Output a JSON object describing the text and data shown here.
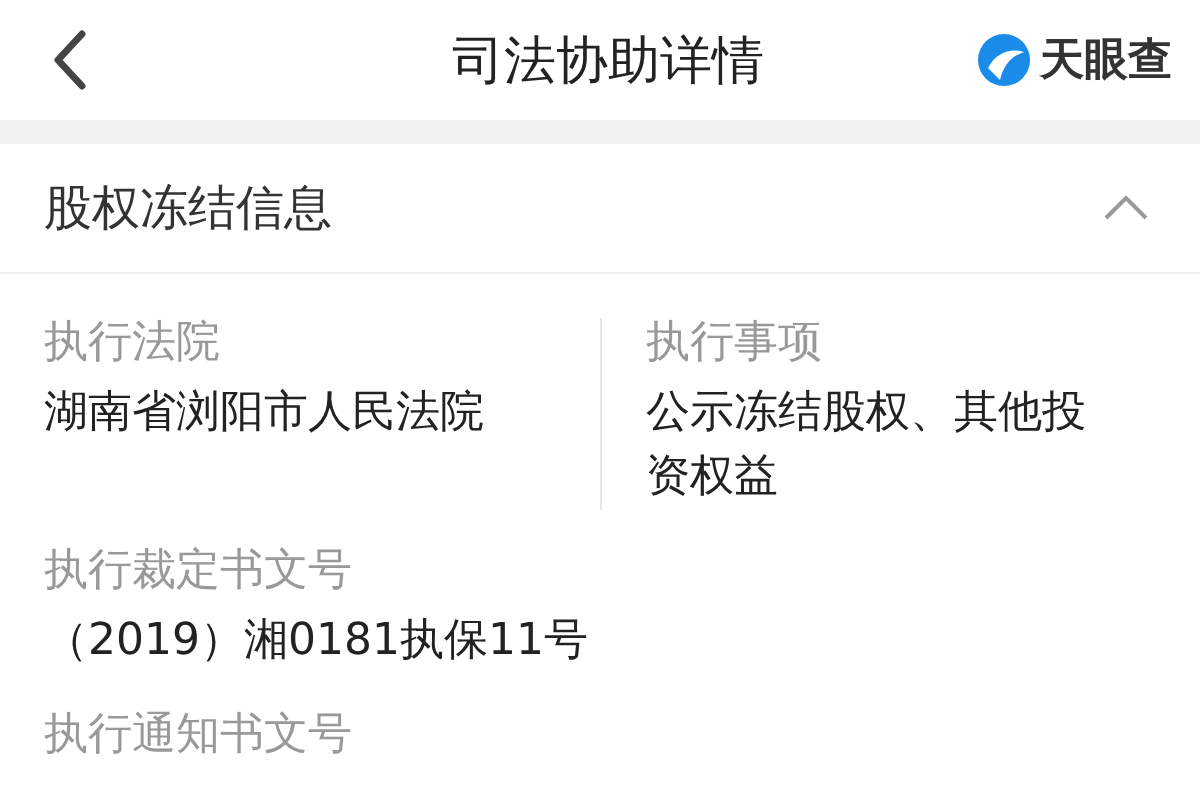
{
  "header": {
    "title": "司法协助详情",
    "logo_text": "天眼查"
  },
  "section": {
    "title": "股权冻结信息",
    "expanded": true,
    "rows": [
      {
        "fields": [
          {
            "label": "执行法院",
            "value": "湖南省浏阳市人民法院"
          },
          {
            "label": "执行事项",
            "value": "公示冻结股权、其他投资权益"
          }
        ]
      },
      {
        "fields": [
          {
            "label": "执行裁定书文号",
            "value": "（2019）湘0181执保11号"
          }
        ]
      },
      {
        "fields": [
          {
            "label": "执行通知书文号"
          }
        ]
      }
    ]
  }
}
